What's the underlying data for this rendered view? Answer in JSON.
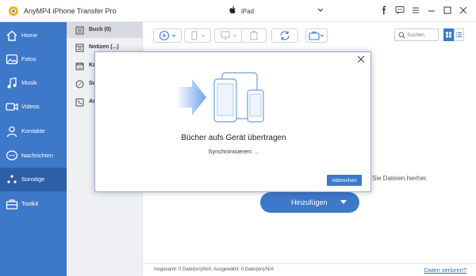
{
  "app": {
    "title": "AnyMP4 iPhone Transfer Pro"
  },
  "device": {
    "name": "iPad"
  },
  "sidebar": {
    "items": [
      {
        "label": "Home",
        "icon": "home-icon"
      },
      {
        "label": "Fotos",
        "icon": "photo-icon"
      },
      {
        "label": "Musik",
        "icon": "music-icon"
      },
      {
        "label": "Videos",
        "icon": "video-icon"
      },
      {
        "label": "Kontakte",
        "icon": "contacts-icon"
      },
      {
        "label": "Nachrichten",
        "icon": "messages-icon"
      },
      {
        "label": "Sonstige",
        "icon": "others-icon",
        "active": true
      },
      {
        "label": "Toolkit",
        "icon": "toolkit-icon"
      }
    ]
  },
  "subpanel": {
    "items": [
      {
        "label": "Buch (0)",
        "active": true
      },
      {
        "label": "Notizen (...)"
      },
      {
        "label": "Ka"
      },
      {
        "label": "Sa"
      },
      {
        "label": "An"
      }
    ]
  },
  "search": {
    "placeholder": "Suchen"
  },
  "main": {
    "hint": "Sie Dateien hierher.",
    "add_button": "Hinzufügen"
  },
  "status": {
    "summary": "Insgesamt: 0 Datei(en)/N/A; Ausgewählt: 0 Datei(en)/N/A",
    "lost_link": "Daten verloren?"
  },
  "modal": {
    "title": "Bücher aufs Gerät übertragen",
    "subtitle": "Synchronisieren: ...",
    "cancel": "Abbrechen"
  },
  "colors": {
    "accent": "#3d78c9",
    "sidebar_active": "#2c5fa8"
  }
}
